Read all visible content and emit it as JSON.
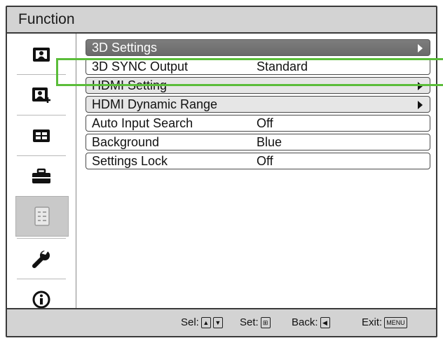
{
  "window": {
    "title": "Function"
  },
  "sidebar": {
    "items": [
      {
        "icon": "picture-icon"
      },
      {
        "icon": "picture-plus-icon"
      },
      {
        "icon": "screen-icon"
      },
      {
        "icon": "toolbox-icon"
      },
      {
        "icon": "function-list-icon",
        "selected": true
      },
      {
        "icon": "wrench-icon"
      },
      {
        "icon": "info-icon"
      }
    ]
  },
  "menu": {
    "items": [
      {
        "label": "3D Settings",
        "value": "",
        "submenu": true
      },
      {
        "label": "3D SYNC Output",
        "value": "Standard",
        "submenu": false
      },
      {
        "label": "HDMI Setting",
        "value": "",
        "submenu": true
      },
      {
        "label": "HDMI Dynamic Range",
        "value": "",
        "submenu": true
      },
      {
        "label": "Auto Input Search",
        "value": "Off",
        "submenu": false
      },
      {
        "label": "Background",
        "value": "Blue",
        "submenu": false
      },
      {
        "label": "Settings Lock",
        "value": "Off",
        "submenu": false
      }
    ]
  },
  "statusbar": {
    "sel_label": "Sel:",
    "set_label": "Set:",
    "back_label": "Back:",
    "exit_label": "Exit:",
    "menu_key": "MENU"
  },
  "colors": {
    "highlight": "#5bbd3a",
    "header_row": "#777777",
    "bars": "#d3d3d3"
  }
}
